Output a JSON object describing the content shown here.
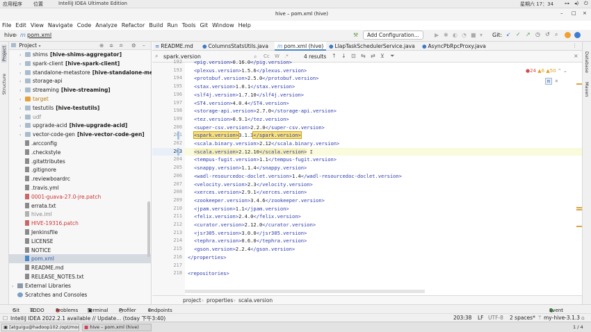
{
  "system_bar": {
    "apps": "应用程序",
    "places": "位置",
    "active_app": "IntelliJ IDEA Ultimate Edition",
    "clock": "星期六 17：34"
  },
  "window": {
    "title": "hive – pom.xml (hive)"
  },
  "menu": [
    "File",
    "Edit",
    "View",
    "Navigate",
    "Code",
    "Analyze",
    "Refactor",
    "Build",
    "Run",
    "Tools",
    "Git",
    "Window",
    "Help"
  ],
  "nav": {
    "project": "hive",
    "file": "pom.xml"
  },
  "toolbar": {
    "add_config": "Add Configuration...",
    "git_label": "Git:"
  },
  "project_panel": {
    "title": "Project",
    "items": [
      {
        "label": "shims",
        "module": "[hive-shims-aggregator]",
        "type": "folder",
        "arrow": "›"
      },
      {
        "label": "spark-client",
        "module": "[hive-spark-client]",
        "type": "folder",
        "arrow": "›"
      },
      {
        "label": "standalone-metastore",
        "module": "[hive-standalone-metastore]",
        "type": "folder",
        "arrow": "›"
      },
      {
        "label": "storage-api",
        "module": "",
        "type": "folder",
        "arrow": "›"
      },
      {
        "label": "streaming",
        "module": "[hive-streaming]",
        "type": "folder",
        "arrow": "›"
      },
      {
        "label": "target",
        "module": "",
        "type": "orange",
        "arrow": "›"
      },
      {
        "label": "testutils",
        "module": "[hive-testutils]",
        "type": "folder",
        "arrow": "›"
      },
      {
        "label": "udf",
        "module": "",
        "type": "folder",
        "arrow": "›"
      },
      {
        "label": "upgrade-acid",
        "module": "[hive-upgrade-acid]",
        "type": "folder",
        "arrow": "›"
      },
      {
        "label": "vector-code-gen",
        "module": "[hive-vector-code-gen]",
        "type": "folder",
        "arrow": "›"
      },
      {
        "label": ".arcconfig",
        "module": "",
        "type": "file",
        "arrow": ""
      },
      {
        "label": ".checkstyle",
        "module": "",
        "type": "file",
        "arrow": ""
      },
      {
        "label": ".gitattributes",
        "module": "",
        "type": "file",
        "arrow": ""
      },
      {
        "label": ".gitignore",
        "module": "",
        "type": "file",
        "arrow": ""
      },
      {
        "label": ".reviewboardrc",
        "module": "",
        "type": "file",
        "arrow": ""
      },
      {
        "label": ".travis.yml",
        "module": "",
        "type": "file",
        "arrow": ""
      },
      {
        "label": "0001-guava-27.0-jre.patch",
        "module": "",
        "type": "file-red",
        "arrow": ""
      },
      {
        "label": "errata.txt",
        "module": "",
        "type": "file",
        "arrow": ""
      },
      {
        "label": "hive.iml",
        "module": "",
        "type": "file-grey",
        "arrow": ""
      },
      {
        "label": "HIVE-19316.patch",
        "module": "",
        "type": "file-red",
        "arrow": ""
      },
      {
        "label": "Jenkinsfile",
        "module": "",
        "type": "file",
        "arrow": ""
      },
      {
        "label": "LICENSE",
        "module": "",
        "type": "file",
        "arrow": ""
      },
      {
        "label": "NOTICE",
        "module": "",
        "type": "file",
        "arrow": ""
      },
      {
        "label": "pom.xml",
        "module": "",
        "type": "file-blue",
        "arrow": "",
        "selected": true
      },
      {
        "label": "README.md",
        "module": "",
        "type": "file",
        "arrow": ""
      },
      {
        "label": "RELEASE_NOTES.txt",
        "module": "",
        "type": "file",
        "arrow": ""
      },
      {
        "label": "External Libraries",
        "module": "",
        "type": "lib",
        "arrow": "›"
      },
      {
        "label": "Scratches and Consoles",
        "module": "",
        "type": "scratch",
        "arrow": ""
      }
    ]
  },
  "tabs": [
    {
      "label": "README.md",
      "active": false
    },
    {
      "label": "ColumnsStatsUtils.java",
      "active": false
    },
    {
      "label": "pom.xml (hive)",
      "active": true
    },
    {
      "label": "LlapTaskSchedulerService.java",
      "active": false
    },
    {
      "label": "AsyncPbRpcProxy.java",
      "active": false
    }
  ],
  "search": {
    "query": "spark.version",
    "results": "4 results",
    "match_case": "Cc",
    "words": "W",
    "regex": ".*"
  },
  "inspections": {
    "errors": "24",
    "warnings": "6",
    "weak": "50"
  },
  "code_lines": [
    {
      "n": "192",
      "open": "<pig.version>",
      "val": "0.16.0",
      "close": "</pig.version>"
    },
    {
      "n": "193",
      "open": "<plexus.version>",
      "val": "1.5.6",
      "close": "</plexus.version>"
    },
    {
      "n": "194",
      "open": "<protobuf.version>",
      "val": "2.5.0",
      "close": "</protobuf.version>"
    },
    {
      "n": "195",
      "open": "<stax.version>",
      "val": "1.0.1",
      "close": "</stax.version>"
    },
    {
      "n": "196",
      "open": "<slf4j.version>",
      "val": "1.7.10",
      "close": "</slf4j.version>"
    },
    {
      "n": "197",
      "open": "<ST4.version>",
      "val": "4.0.4",
      "close": "</ST4.version>"
    },
    {
      "n": "198",
      "open": "<storage-api.version>",
      "val": "2.7.0",
      "close": "</storage-api.version>"
    },
    {
      "n": "199",
      "open": "<tez.version>",
      "val": "0.9.1",
      "close": "</tez.version>"
    },
    {
      "n": "200",
      "open": "<super-csv.version>",
      "val": "2.2.0",
      "close": "</super-csv.version>"
    },
    {
      "n": "201",
      "open": "<spark.version>",
      "val": "3.1.3",
      "close": "</spark.version>"
    },
    {
      "n": "202",
      "open": "<scala.binary.version>",
      "val": "2.12",
      "close": "</scala.binary.version>"
    },
    {
      "n": "203",
      "open": "<scala.version>",
      "val": "2.12.10",
      "close": "</scala.version>"
    },
    {
      "n": "204",
      "open": "<tempus-fugit.version>",
      "val": "1.1",
      "close": "</tempus-fugit.version>"
    },
    {
      "n": "205",
      "open": "<snappy.version>",
      "val": "1.1.4",
      "close": "</snappy.version>"
    },
    {
      "n": "206",
      "open": "<wadl-resourcedoc-doclet.version>",
      "val": "1.4",
      "close": "</wadl-resourcedoc-doclet.version>"
    },
    {
      "n": "207",
      "open": "<velocity.version>",
      "val": "2.3",
      "close": "</velocity.version>"
    },
    {
      "n": "208",
      "open": "<xerces.version>",
      "val": "2.9.1",
      "close": "</xerces.version>"
    },
    {
      "n": "209",
      "open": "<zookeeper.version>",
      "val": "3.4.6",
      "close": "</zookeeper.version>"
    },
    {
      "n": "210",
      "open": "<jpam.version>",
      "val": "1.1",
      "close": "</jpam.version>"
    },
    {
      "n": "211",
      "open": "<felix.version>",
      "val": "2.4.0",
      "close": "</felix.version>"
    },
    {
      "n": "212",
      "open": "<curator.version>",
      "val": "2.12.0",
      "close": "</curator.version>"
    },
    {
      "n": "213",
      "open": "<jsr305.version>",
      "val": "3.0.0",
      "close": "</jsr305.version>"
    },
    {
      "n": "214",
      "open": "<tephra.version>",
      "val": "0.6.0",
      "close": "</tephra.version>"
    },
    {
      "n": "215",
      "open": "<gson.version>",
      "val": "2.2.4",
      "close": "</gson.version>"
    },
    {
      "n": "216",
      "open": "</properties>",
      "val": "",
      "close": ""
    },
    {
      "n": "217",
      "open": "",
      "val": "",
      "close": ""
    },
    {
      "n": "218",
      "open": "<repositories>",
      "val": "",
      "close": ""
    }
  ],
  "breadcrumb": [
    "project",
    "properties",
    "scala.version"
  ],
  "bottom_tools": {
    "git": "Git",
    "todo": "TODO",
    "problems": "Problems",
    "terminal": "Terminal",
    "profiler": "Profiler",
    "endpoints": "Endpoints",
    "event_log": "Event Log"
  },
  "status": {
    "message": "IntelliJ IDEA 2022.2.1 available // Update... (today 下午3:40)",
    "position": "203:38",
    "line_sep": "LF",
    "encoding": "UTF-8",
    "indent": "2 spaces*",
    "branch": "my-hive-3.1.3"
  },
  "side_tabs": {
    "project": "Project",
    "structure": "Structure",
    "database": "Database",
    "maven": "Maven"
  },
  "taskbar": {
    "terminal": "[atguigu@hadoop102:/opt/module/...",
    "idea": "hive – pom.xml (hive)",
    "pages": "1 / 4"
  }
}
